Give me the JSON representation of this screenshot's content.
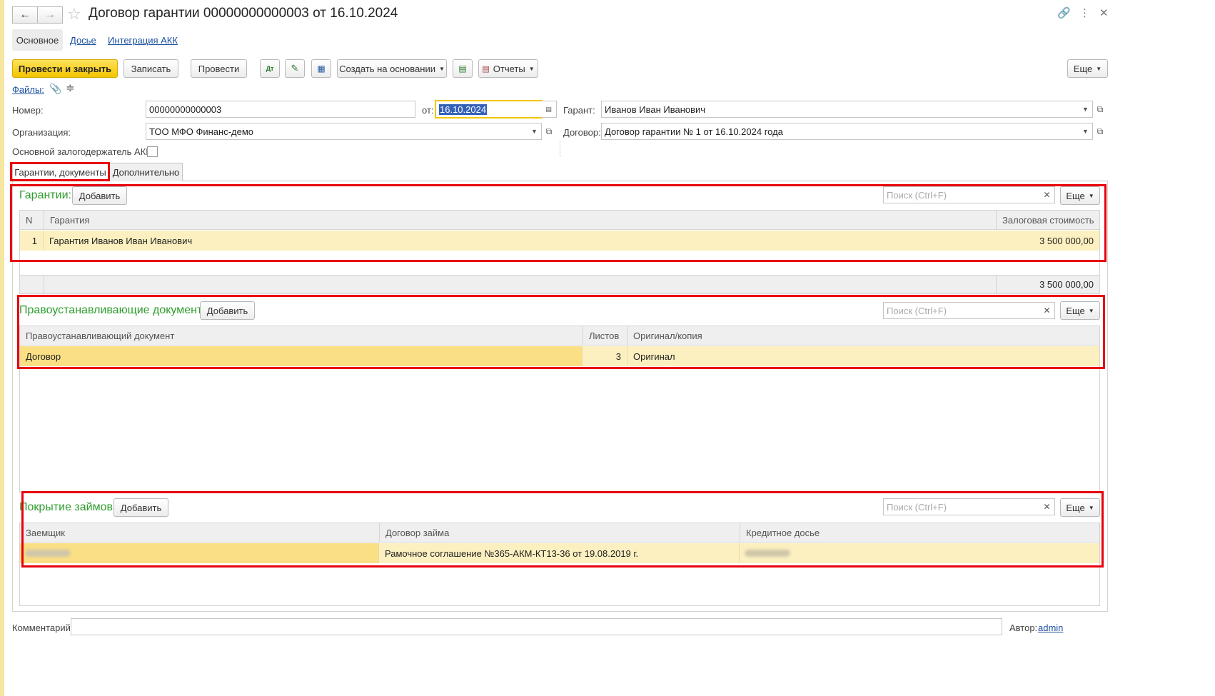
{
  "window": {
    "title": "Договор гарантии 00000000000003 от 16.10.2024",
    "nav_tabs": [
      "Основное",
      "Досье",
      "Интеграция АКК"
    ]
  },
  "toolbar": {
    "post_close": "Провести и закрыть",
    "save": "Записать",
    "post": "Провести",
    "create_based": "Создать на основании",
    "reports": "Отчеты",
    "more": "Еще"
  },
  "files_link": "Файлы:",
  "form": {
    "number_label": "Номер:",
    "number_value": "00000000000003",
    "date_label": "от:",
    "date_value": "16.10.2024",
    "guarantor_label": "Гарант:",
    "guarantor_value": "Иванов Иван Иванович",
    "org_label": "Организация:",
    "org_value": "ТОО МФО Финанс-демо",
    "contract_label": "Договор:",
    "contract_value": "Договор гарантии № 1 от 16.10.2024 года",
    "main_pledge_label": "Основной залогодержатель АКК:"
  },
  "tabs": [
    "Гарантии, документы",
    "Дополнительно"
  ],
  "guarantees": {
    "title": "Гарантии:",
    "add": "Добавить",
    "search_placeholder": "Поиск (Ctrl+F)",
    "more": "Еще",
    "columns": [
      "N",
      "Гарантия",
      "Залоговая стоимость"
    ],
    "rows": [
      [
        "1",
        "Гарантия Иванов Иван Иванович",
        "3 500 000,00"
      ]
    ],
    "total": "3 500 000,00"
  },
  "title_docs": {
    "title": "Правоустанавливающие документы:",
    "add": "Добавить",
    "search_placeholder": "Поиск (Ctrl+F)",
    "more": "Еще",
    "columns": [
      "Правоустанавливающий документ",
      "Листов",
      "Оригинал/копия"
    ],
    "rows": [
      [
        "Договор",
        "3",
        "Оригинал"
      ]
    ]
  },
  "loans": {
    "title": "Покрытие займов:",
    "add": "Добавить",
    "search_placeholder": "Поиск (Ctrl+F)",
    "more": "Еще",
    "columns": [
      "Заемщик",
      "Договор займа",
      "Кредитное досье"
    ],
    "rows": [
      [
        "",
        "Рамочное соглашение №365-АКМ-КТ13-36 от 19.08.2019 г.",
        ""
      ]
    ]
  },
  "footer": {
    "comment_label": "Комментарий:",
    "author_label": "Автор:",
    "author_value": "admin"
  }
}
